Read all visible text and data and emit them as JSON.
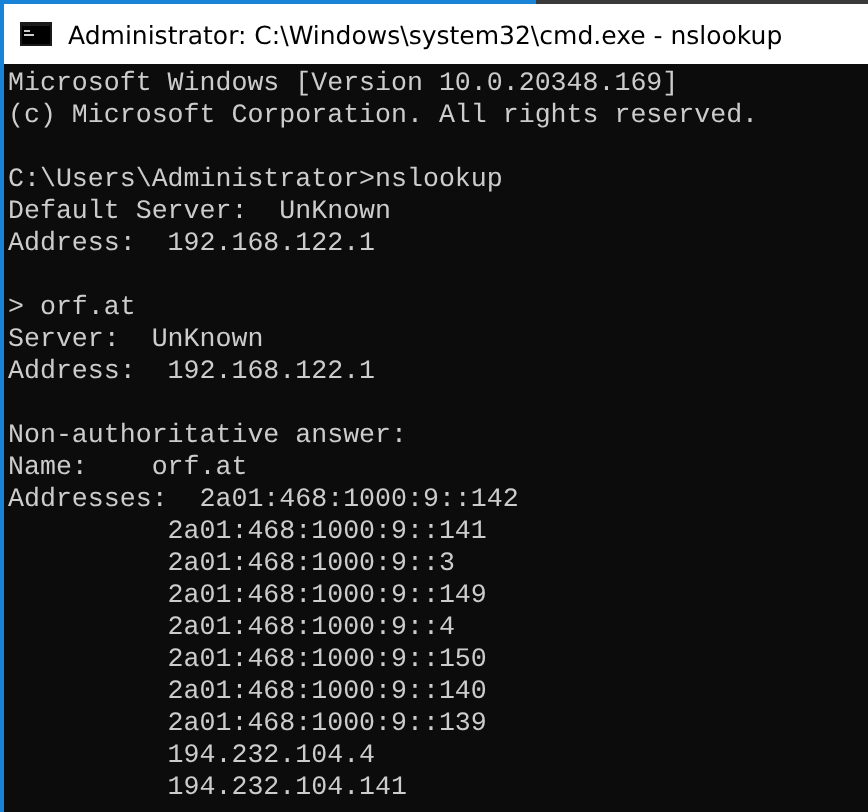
{
  "window": {
    "title": "Administrator: C:\\Windows\\system32\\cmd.exe - nslookup"
  },
  "console": {
    "blocks": [
      [
        "Microsoft Windows [Version 10.0.20348.169]",
        "(c) Microsoft Corporation. All rights reserved."
      ],
      [
        "C:\\Users\\Administrator>nslookup",
        "Default Server:  UnKnown",
        "Address:  192.168.122.1"
      ],
      [
        "> orf.at",
        "Server:  UnKnown",
        "Address:  192.168.122.1"
      ],
      [
        "Non-authoritative answer:",
        "Name:    orf.at",
        "Addresses:  2a01:468:1000:9::142",
        "          2a01:468:1000:9::141",
        "          2a01:468:1000:9::3",
        "          2a01:468:1000:9::149",
        "          2a01:468:1000:9::4",
        "          2a01:468:1000:9::150",
        "          2a01:468:1000:9::140",
        "          2a01:468:1000:9::139",
        "          194.232.104.4",
        "          194.232.104.141"
      ]
    ]
  }
}
